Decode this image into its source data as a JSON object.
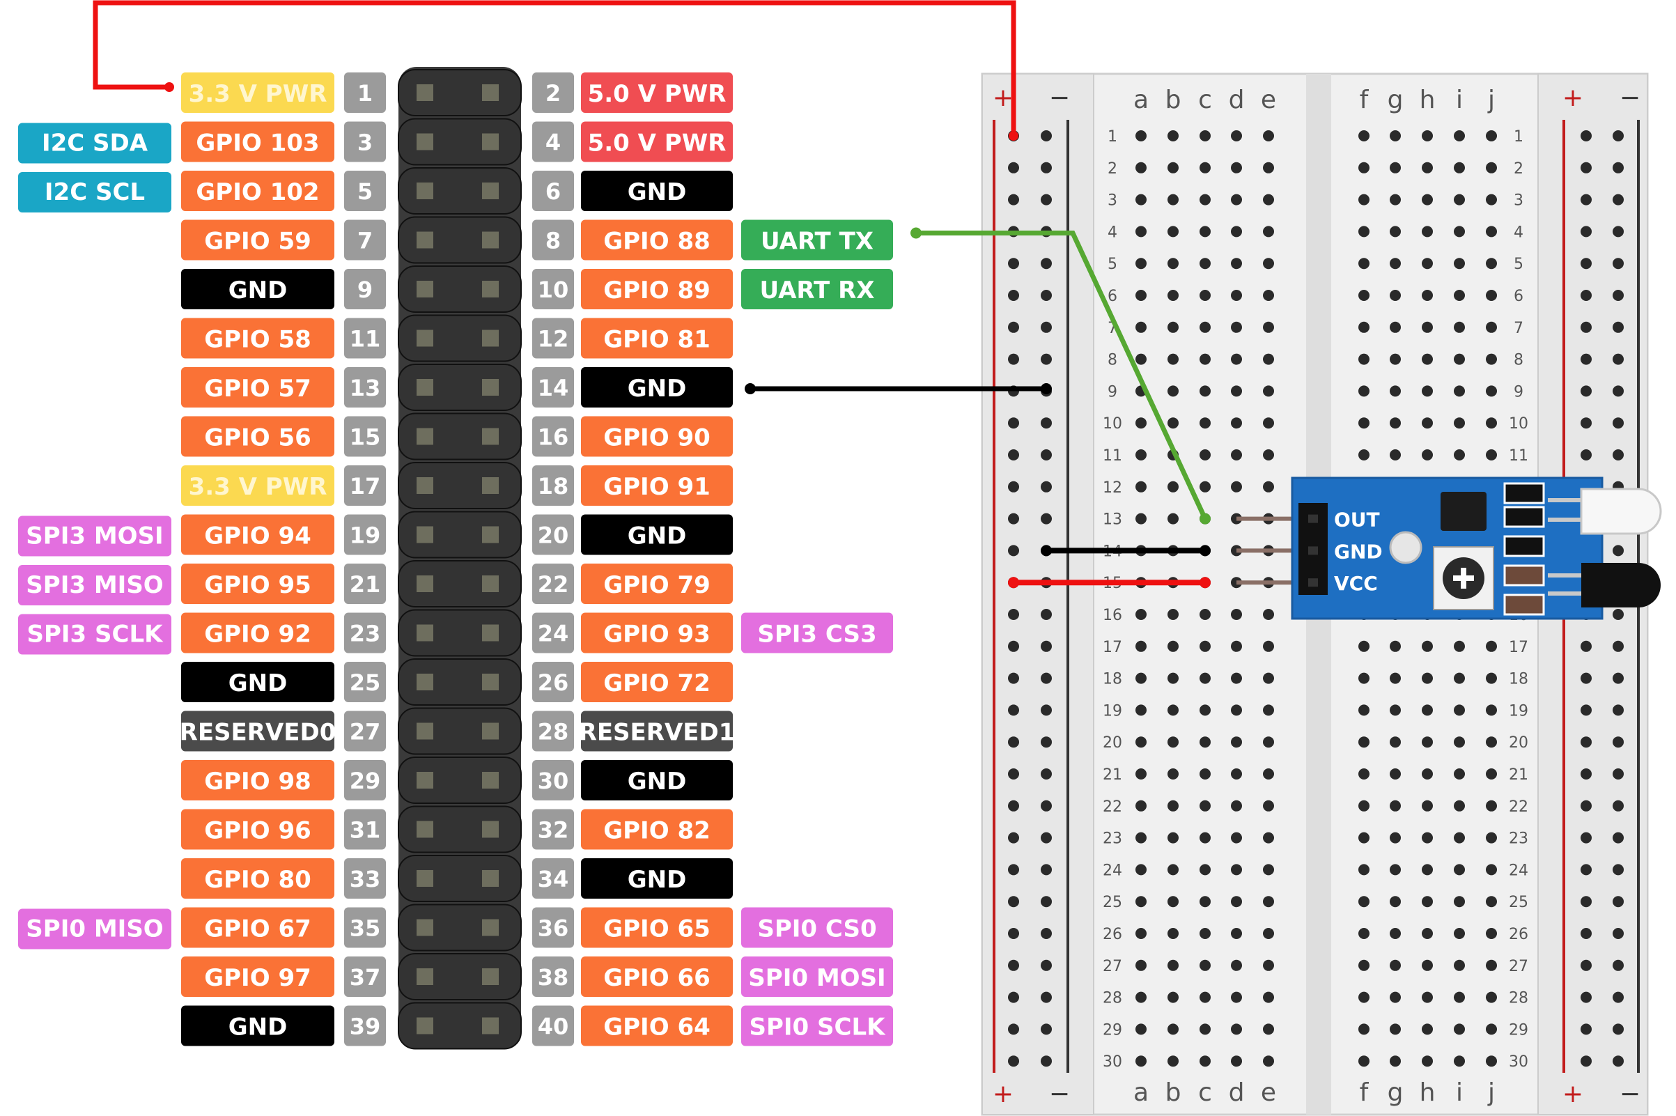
{
  "colors": {
    "power3v3": "#fbd950",
    "power5v": "#f04d52",
    "gpio": "#fa7236",
    "gnd": "#000000",
    "reserved": "#4b4b4b",
    "i2c": "#1aa6c6",
    "spi": "#e36fdf",
    "uart": "#35ad57",
    "pin_number": "#9b9b9b",
    "wire_power": "#ee1111",
    "wire_signal": "#56a832",
    "wire_ground": "#000000",
    "module_board": "#1e6fc2"
  },
  "header": {
    "rows": [
      {
        "l_num": "1",
        "l_label": "3.3 V PWR",
        "l_kind": "power3v3",
        "l_extra": "",
        "l_extra_kind": "",
        "r_num": "2",
        "r_label": "5.0 V PWR",
        "r_kind": "power5v",
        "r_extra": "",
        "r_extra_kind": ""
      },
      {
        "l_num": "3",
        "l_label": "GPIO 103",
        "l_kind": "gpio",
        "l_extra": "I2C SDA",
        "l_extra_kind": "i2c",
        "r_num": "4",
        "r_label": "5.0 V PWR",
        "r_kind": "power5v",
        "r_extra": "",
        "r_extra_kind": ""
      },
      {
        "l_num": "5",
        "l_label": "GPIO 102",
        "l_kind": "gpio",
        "l_extra": "I2C SCL",
        "l_extra_kind": "i2c",
        "r_num": "6",
        "r_label": "GND",
        "r_kind": "gnd",
        "r_extra": "",
        "r_extra_kind": ""
      },
      {
        "l_num": "7",
        "l_label": "GPIO 59",
        "l_kind": "gpio",
        "l_extra": "",
        "l_extra_kind": "",
        "r_num": "8",
        "r_label": "GPIO 88",
        "r_kind": "gpio",
        "r_extra": "UART TX",
        "r_extra_kind": "uart"
      },
      {
        "l_num": "9",
        "l_label": "GND",
        "l_kind": "gnd",
        "l_extra": "",
        "l_extra_kind": "",
        "r_num": "10",
        "r_label": "GPIO 89",
        "r_kind": "gpio",
        "r_extra": "UART RX",
        "r_extra_kind": "uart"
      },
      {
        "l_num": "11",
        "l_label": "GPIO 58",
        "l_kind": "gpio",
        "l_extra": "",
        "l_extra_kind": "",
        "r_num": "12",
        "r_label": "GPIO 81",
        "r_kind": "gpio",
        "r_extra": "",
        "r_extra_kind": ""
      },
      {
        "l_num": "13",
        "l_label": "GPIO 57",
        "l_kind": "gpio",
        "l_extra": "",
        "l_extra_kind": "",
        "r_num": "14",
        "r_label": "GND",
        "r_kind": "gnd",
        "r_extra": "",
        "r_extra_kind": ""
      },
      {
        "l_num": "15",
        "l_label": "GPIO 56",
        "l_kind": "gpio",
        "l_extra": "",
        "l_extra_kind": "",
        "r_num": "16",
        "r_label": "GPIO 90",
        "r_kind": "gpio",
        "r_extra": "",
        "r_extra_kind": ""
      },
      {
        "l_num": "17",
        "l_label": "3.3 V PWR",
        "l_kind": "power3v3",
        "l_extra": "",
        "l_extra_kind": "",
        "r_num": "18",
        "r_label": "GPIO 91",
        "r_kind": "gpio",
        "r_extra": "",
        "r_extra_kind": ""
      },
      {
        "l_num": "19",
        "l_label": "GPIO 94",
        "l_kind": "gpio",
        "l_extra": "SPI3 MOSI",
        "l_extra_kind": "spi",
        "r_num": "20",
        "r_label": "GND",
        "r_kind": "gnd",
        "r_extra": "",
        "r_extra_kind": ""
      },
      {
        "l_num": "21",
        "l_label": "GPIO 95",
        "l_kind": "gpio",
        "l_extra": "SPI3 MISO",
        "l_extra_kind": "spi",
        "r_num": "22",
        "r_label": "GPIO 79",
        "r_kind": "gpio",
        "r_extra": "",
        "r_extra_kind": ""
      },
      {
        "l_num": "23",
        "l_label": "GPIO 92",
        "l_kind": "gpio",
        "l_extra": "SPI3 SCLK",
        "l_extra_kind": "spi",
        "r_num": "24",
        "r_label": "GPIO 93",
        "r_kind": "gpio",
        "r_extra": "SPI3 CS3",
        "r_extra_kind": "spi"
      },
      {
        "l_num": "25",
        "l_label": "GND",
        "l_kind": "gnd",
        "l_extra": "",
        "l_extra_kind": "",
        "r_num": "26",
        "r_label": "GPIO 72",
        "r_kind": "gpio",
        "r_extra": "",
        "r_extra_kind": ""
      },
      {
        "l_num": "27",
        "l_label": "RESERVED0",
        "l_kind": "reserved",
        "l_extra": "",
        "l_extra_kind": "",
        "r_num": "28",
        "r_label": "RESERVED1",
        "r_kind": "reserved",
        "r_extra": "",
        "r_extra_kind": ""
      },
      {
        "l_num": "29",
        "l_label": "GPIO 98",
        "l_kind": "gpio",
        "l_extra": "",
        "l_extra_kind": "",
        "r_num": "30",
        "r_label": "GND",
        "r_kind": "gnd",
        "r_extra": "",
        "r_extra_kind": ""
      },
      {
        "l_num": "31",
        "l_label": "GPIO 96",
        "l_kind": "gpio",
        "l_extra": "",
        "l_extra_kind": "",
        "r_num": "32",
        "r_label": "GPIO 82",
        "r_kind": "gpio",
        "r_extra": "",
        "r_extra_kind": ""
      },
      {
        "l_num": "33",
        "l_label": "GPIO 80",
        "l_kind": "gpio",
        "l_extra": "",
        "l_extra_kind": "",
        "r_num": "34",
        "r_label": "GND",
        "r_kind": "gnd",
        "r_extra": "",
        "r_extra_kind": ""
      },
      {
        "l_num": "35",
        "l_label": "GPIO 67",
        "l_kind": "gpio",
        "l_extra": "SPI0 MISO",
        "l_extra_kind": "spi",
        "r_num": "36",
        "r_label": "GPIO 65",
        "r_kind": "gpio",
        "r_extra": "SPI0 CS0",
        "r_extra_kind": "spi"
      },
      {
        "l_num": "37",
        "l_label": "GPIO 97",
        "l_kind": "gpio",
        "l_extra": "",
        "l_extra_kind": "",
        "r_num": "38",
        "r_label": "GPIO 66",
        "r_kind": "gpio",
        "r_extra": "SPI0 MOSI",
        "r_extra_kind": "spi"
      },
      {
        "l_num": "39",
        "l_label": "GND",
        "l_kind": "gnd",
        "l_extra": "",
        "l_extra_kind": "",
        "r_num": "40",
        "r_label": "GPIO 64",
        "r_kind": "gpio",
        "r_extra": "SPI0 SCLK",
        "r_extra_kind": "spi"
      }
    ]
  },
  "breadboard": {
    "plus": "+",
    "minus": "−",
    "columns_left": [
      "a",
      "b",
      "c",
      "d",
      "e"
    ],
    "columns_right": [
      "f",
      "g",
      "h",
      "i",
      "j"
    ],
    "rows": [
      "1",
      "2",
      "3",
      "4",
      "5",
      "6",
      "7",
      "8",
      "9",
      "10",
      "11",
      "12",
      "13",
      "14",
      "15",
      "16",
      "17",
      "18",
      "19",
      "20",
      "21",
      "22",
      "23",
      "24",
      "25",
      "26",
      "27",
      "28",
      "29",
      "30"
    ]
  },
  "sensor_module": {
    "pins": [
      "OUT",
      "GND",
      "VCC"
    ]
  }
}
